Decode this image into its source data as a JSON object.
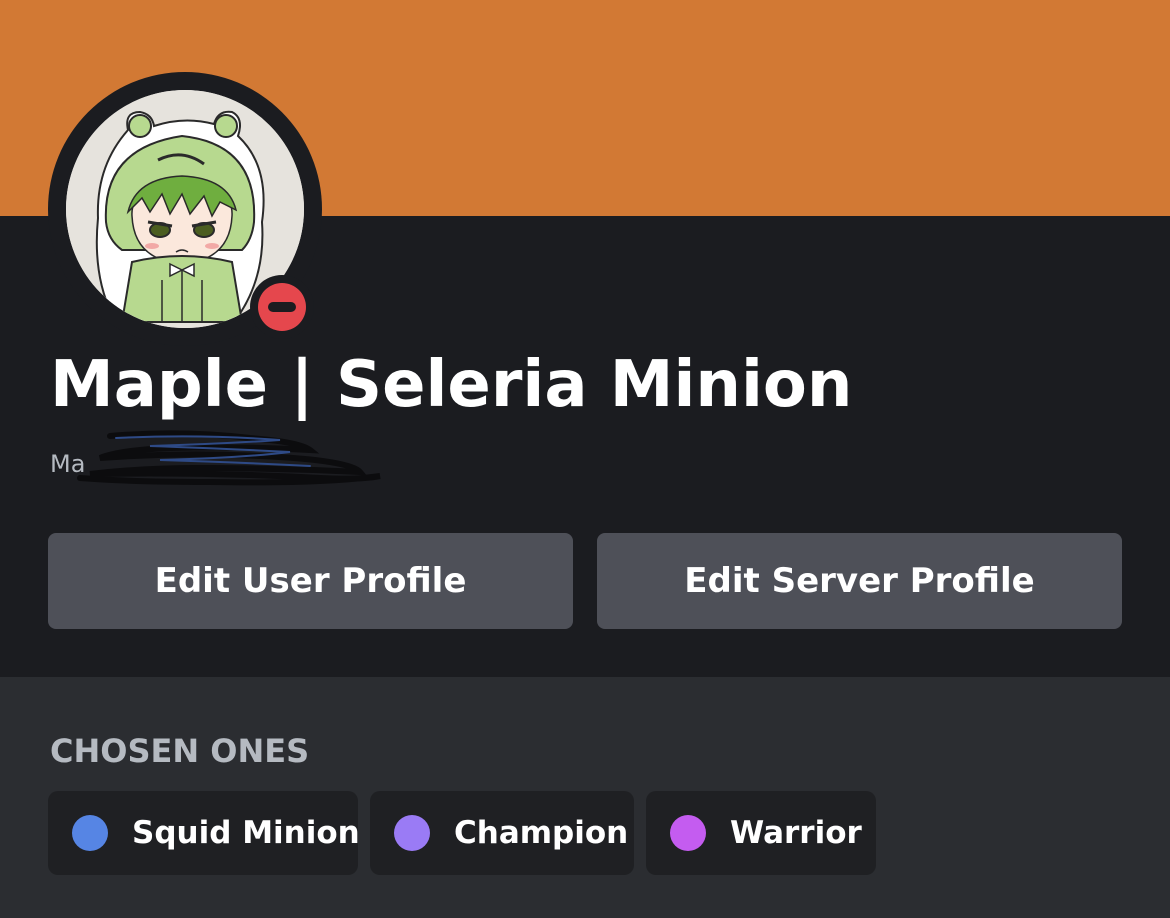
{
  "banner": {
    "color": "#d27934"
  },
  "avatar": {
    "icon": "green-hooded-character-avatar"
  },
  "status": {
    "icon": "do-not-disturb-icon",
    "color": "#e5474d"
  },
  "profile": {
    "display_name": "Maple | Seleria Minion",
    "username_visible": "Ma"
  },
  "buttons": {
    "edit_user_profile": "Edit User Profile",
    "edit_server_profile": "Edit Server Profile"
  },
  "roles": {
    "title": "CHOSEN ONES",
    "items": [
      {
        "label": "Squid Minion",
        "color": "#5685e4"
      },
      {
        "label": "Champion",
        "color": "#9a7bf5"
      },
      {
        "label": "Warrior",
        "color": "#c45cf0"
      }
    ]
  }
}
